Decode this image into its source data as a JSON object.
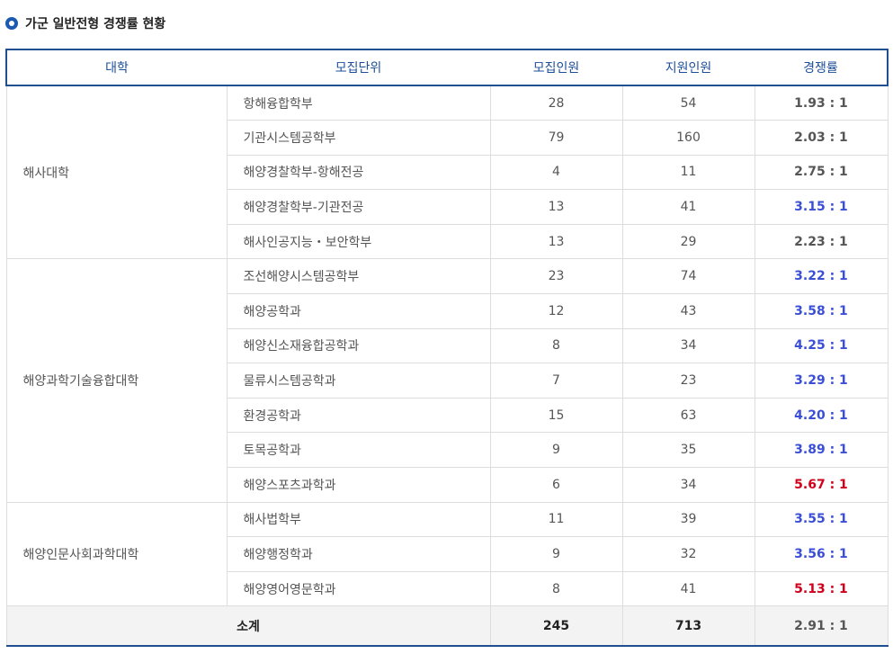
{
  "heading": "가군 일반전형 경쟁률 현황",
  "columns": [
    "대학",
    "모집단위",
    "모집인원",
    "지원인원",
    "경쟁률"
  ],
  "colors": {
    "header_text": "#1d4f99",
    "border": "#1f4f8f",
    "rate_blue": "#3b4fd6",
    "rate_red": "#d0001b"
  },
  "colleges": [
    {
      "name": "해사대학",
      "rows": [
        {
          "unit": "항해융합학부",
          "quota": "28",
          "applicants": "54",
          "rate": "1.93 : 1",
          "rate_color": "gray"
        },
        {
          "unit": "기관시스템공학부",
          "quota": "79",
          "applicants": "160",
          "rate": "2.03 : 1",
          "rate_color": "gray"
        },
        {
          "unit": "해양경찰학부-항해전공",
          "quota": "4",
          "applicants": "11",
          "rate": "2.75 : 1",
          "rate_color": "gray"
        },
        {
          "unit": "해양경찰학부-기관전공",
          "quota": "13",
          "applicants": "41",
          "rate": "3.15 : 1",
          "rate_color": "blue"
        },
        {
          "unit": "해사인공지능・보안학부",
          "quota": "13",
          "applicants": "29",
          "rate": "2.23 : 1",
          "rate_color": "gray"
        }
      ]
    },
    {
      "name": "해양과학기술융합대학",
      "rows": [
        {
          "unit": "조선해양시스템공학부",
          "quota": "23",
          "applicants": "74",
          "rate": "3.22 : 1",
          "rate_color": "blue"
        },
        {
          "unit": "해양공학과",
          "quota": "12",
          "applicants": "43",
          "rate": "3.58 : 1",
          "rate_color": "blue"
        },
        {
          "unit": "해양신소재융합공학과",
          "quota": "8",
          "applicants": "34",
          "rate": "4.25 : 1",
          "rate_color": "blue"
        },
        {
          "unit": "물류시스템공학과",
          "quota": "7",
          "applicants": "23",
          "rate": "3.29 : 1",
          "rate_color": "blue"
        },
        {
          "unit": "환경공학과",
          "quota": "15",
          "applicants": "63",
          "rate": "4.20 : 1",
          "rate_color": "blue"
        },
        {
          "unit": "토목공학과",
          "quota": "9",
          "applicants": "35",
          "rate": "3.89 : 1",
          "rate_color": "blue"
        },
        {
          "unit": "해양스포츠과학과",
          "quota": "6",
          "applicants": "34",
          "rate": "5.67 : 1",
          "rate_color": "red"
        }
      ]
    },
    {
      "name": "해양인문사회과학대학",
      "rows": [
        {
          "unit": "해사법학부",
          "quota": "11",
          "applicants": "39",
          "rate": "3.55 : 1",
          "rate_color": "blue"
        },
        {
          "unit": "해양행정학과",
          "quota": "9",
          "applicants": "32",
          "rate": "3.56 : 1",
          "rate_color": "blue"
        },
        {
          "unit": "해양영어영문학과",
          "quota": "8",
          "applicants": "41",
          "rate": "5.13 : 1",
          "rate_color": "red"
        }
      ]
    }
  ],
  "total": {
    "label": "소계",
    "quota": "245",
    "applicants": "713",
    "rate": "2.91 : 1"
  }
}
